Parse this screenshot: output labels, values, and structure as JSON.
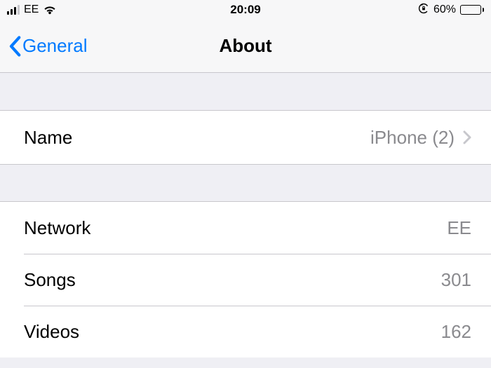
{
  "status": {
    "carrier": "EE",
    "time": "20:09",
    "battery_pct": "60%"
  },
  "nav": {
    "back_label": "General",
    "title": "About"
  },
  "rows": {
    "name": {
      "label": "Name",
      "value": "iPhone (2)"
    },
    "network": {
      "label": "Network",
      "value": "EE"
    },
    "songs": {
      "label": "Songs",
      "value": "301"
    },
    "videos": {
      "label": "Videos",
      "value": "162"
    }
  }
}
